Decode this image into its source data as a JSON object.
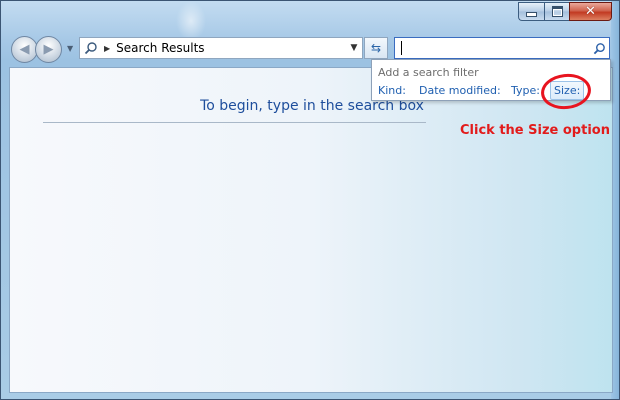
{
  "window": {
    "caption_buttons": {
      "minimize_icon": "minimize-icon",
      "maximize_icon": "maximize-icon",
      "close_icon": "close-icon",
      "close_glyph": "✕"
    }
  },
  "navigation": {
    "back_glyph": "◀",
    "forward_glyph": "▶",
    "address_text": "Search Results",
    "breadcrumb_arrow": "▶",
    "dropdown_glyph": "▼",
    "refresh_glyph": "⇆"
  },
  "search": {
    "value": "",
    "placeholder": ""
  },
  "content": {
    "hint": "To begin, type in the search box"
  },
  "filter_menu": {
    "title": "Add a search filter",
    "options": [
      {
        "label": "Kind:"
      },
      {
        "label": "Date modified:"
      },
      {
        "label": "Type:"
      },
      {
        "label": "Size:"
      }
    ]
  },
  "annotation": {
    "text": "Click the Size option",
    "color": "#e21b1b"
  },
  "colors": {
    "link": "#1f5fb0",
    "hint": "#1e4e9c"
  }
}
